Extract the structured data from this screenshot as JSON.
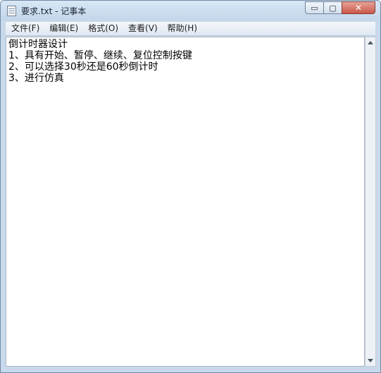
{
  "window": {
    "title": "要求.txt - 记事本",
    "min_glyph": "▭",
    "max_glyph": "▢",
    "close_glyph": "✕"
  },
  "menu": {
    "items": [
      "文件(F)",
      "编辑(E)",
      "格式(O)",
      "查看(V)",
      "帮助(H)"
    ]
  },
  "document": {
    "lines": [
      "倒计时器设计",
      "1、具有开始、暂停、继续、复位控制按键",
      "2、可以选择30秒还是60秒倒计时",
      "3、进行仿真"
    ]
  },
  "icons": {
    "app": "notepad-icon",
    "scroll_up": "arrow-up-icon",
    "scroll_down": "arrow-down-icon"
  }
}
